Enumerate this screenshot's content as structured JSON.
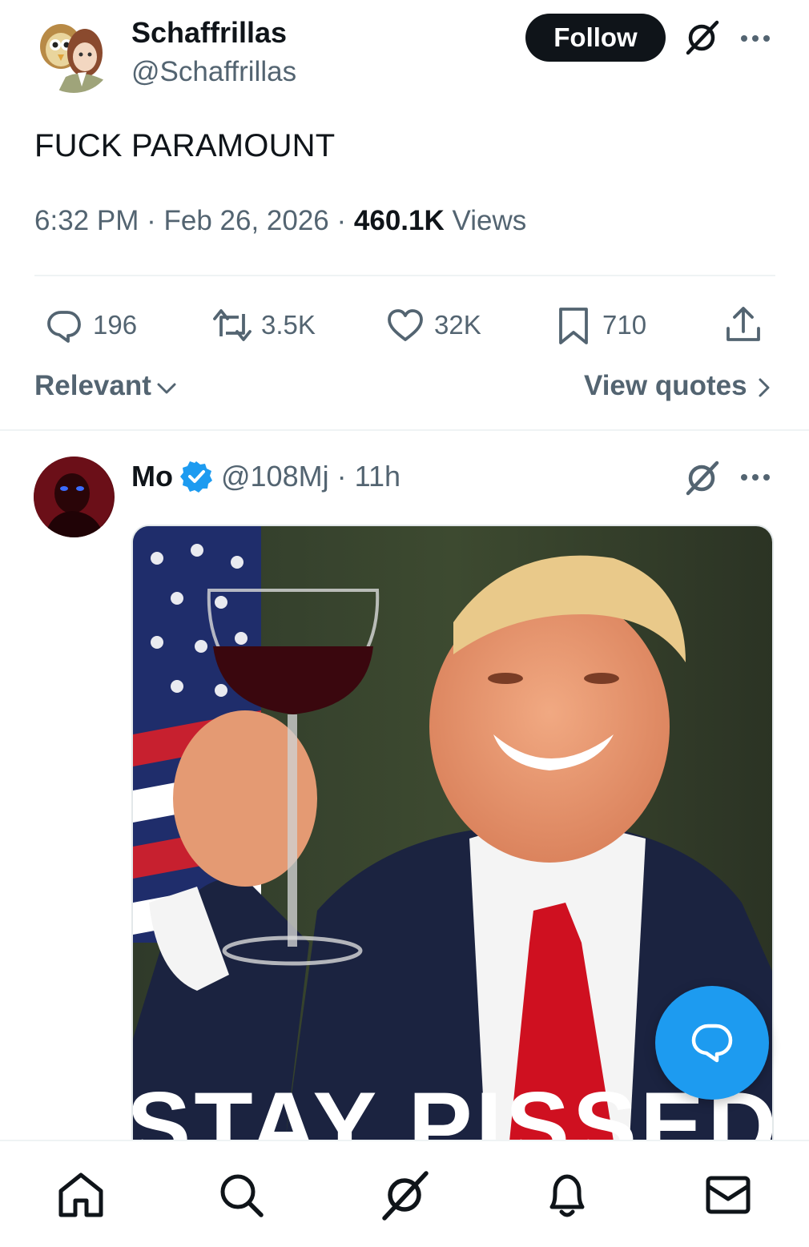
{
  "post": {
    "author_name": "Schaffrillas",
    "author_handle": "@Schaffrillas",
    "follow_label": "Follow",
    "text": "FUCK PARAMOUNT",
    "time": "6:32 PM",
    "date": "Feb 26, 2026",
    "separator": "·",
    "views_count": "460.1K",
    "views_label": "Views"
  },
  "actions": {
    "replies": "196",
    "reposts": "3.5K",
    "likes": "32K",
    "bookmarks": "710"
  },
  "sort": {
    "relevant_label": "Relevant",
    "view_quotes_label": "View quotes"
  },
  "reply": {
    "name": "Mo",
    "handle": "@108Mj",
    "separator": "·",
    "time": "11h",
    "image_caption": "STAY PISSED"
  },
  "icons": {
    "top_right": [
      "grok-icon",
      "more-icon"
    ],
    "actions": [
      "reply-icon",
      "repost-icon",
      "like-icon",
      "bookmark-icon",
      "share-icon"
    ],
    "fab": "reply-fab-icon",
    "tabbar": [
      "home-icon",
      "search-icon",
      "grok-icon",
      "notifications-icon",
      "messages-icon"
    ]
  },
  "colors": {
    "accent": "#1d9bf0",
    "text_primary": "#0f1419",
    "text_secondary": "#536471",
    "follow_bg": "#0f1419",
    "divider": "#eff3f4"
  }
}
